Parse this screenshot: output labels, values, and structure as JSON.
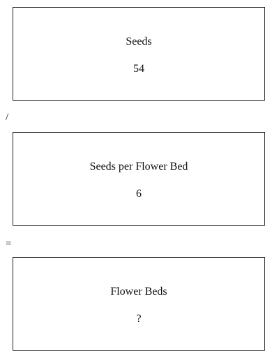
{
  "boxes": [
    {
      "label": "Seeds",
      "value": "54"
    },
    {
      "label": "Seeds per Flower Bed",
      "value": "6"
    },
    {
      "label": "Flower Beds",
      "value": "?"
    }
  ],
  "operators": {
    "divide": "/",
    "equals": "="
  }
}
